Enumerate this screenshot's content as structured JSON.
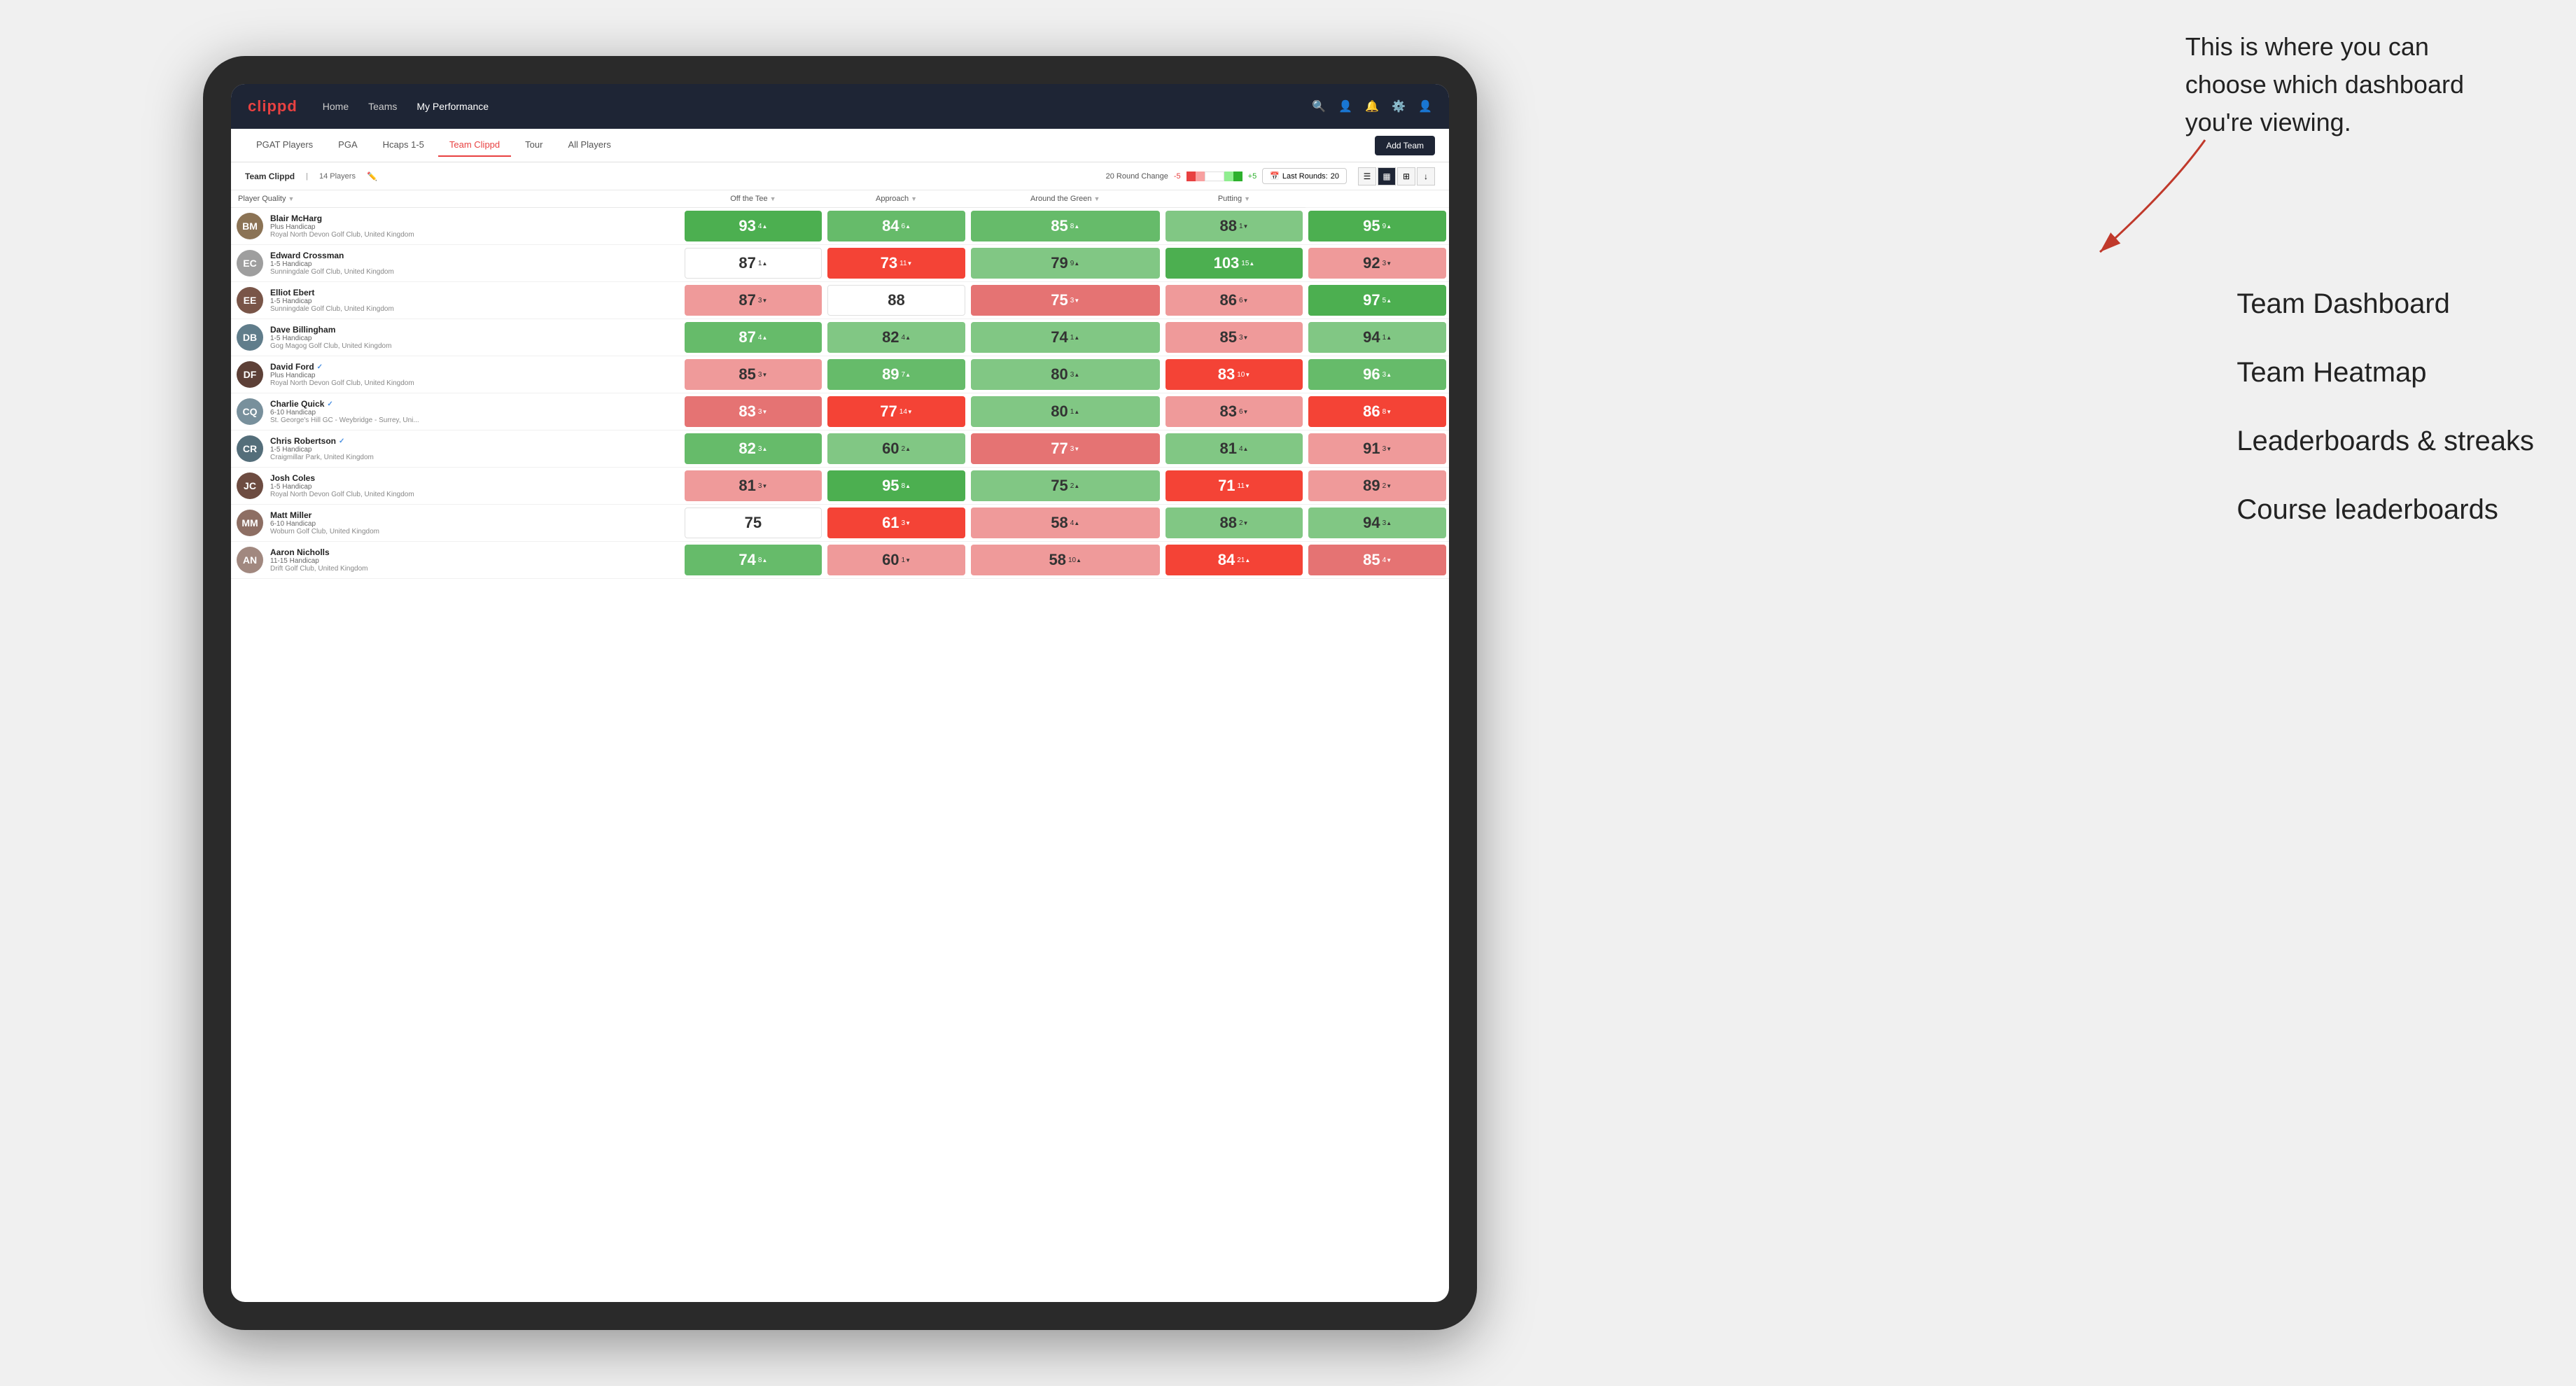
{
  "annotation": {
    "line1": "This is where you can",
    "line2": "choose which dashboard",
    "line3": "you're viewing."
  },
  "dashboard_labels": [
    "Team Dashboard",
    "Team Heatmap",
    "Leaderboards & streaks",
    "Course leaderboards"
  ],
  "nav": {
    "logo": "clippd",
    "links": [
      "Home",
      "Teams",
      "My Performance"
    ],
    "active_link": "My Performance"
  },
  "sub_tabs": {
    "tabs": [
      "PGAT Players",
      "PGA",
      "Hcaps 1-5",
      "Team Clippd",
      "Tour",
      "All Players"
    ],
    "active": "Team Clippd",
    "add_button": "Add Team"
  },
  "team_bar": {
    "name": "Team Clippd",
    "count": "14 Players",
    "round_change_label": "20 Round Change",
    "range_min": "-5",
    "range_max": "+5",
    "last_rounds_label": "Last Rounds:",
    "last_rounds_value": "20"
  },
  "table": {
    "columns": [
      "Player Quality ↓",
      "Off the Tee ↓",
      "Approach ↓",
      "Around the Green ↓",
      "Putting ↓"
    ],
    "players": [
      {
        "name": "Blair McHarg",
        "handicap": "Plus Handicap",
        "club": "Royal North Devon Golf Club, United Kingdom",
        "avatar_color": "#8B7355",
        "initials": "BM",
        "scores": [
          {
            "value": "93",
            "delta": "4",
            "dir": "up",
            "color": "c-green-1"
          },
          {
            "value": "84",
            "delta": "6",
            "dir": "up",
            "color": "c-green-2"
          },
          {
            "value": "85",
            "delta": "8",
            "dir": "up",
            "color": "c-green-2"
          },
          {
            "value": "88",
            "delta": "1",
            "dir": "down",
            "color": "c-green-3"
          },
          {
            "value": "95",
            "delta": "9",
            "dir": "up",
            "color": "c-green-1"
          }
        ]
      },
      {
        "name": "Edward Crossman",
        "handicap": "1-5 Handicap",
        "club": "Sunningdale Golf Club, United Kingdom",
        "avatar_color": "#9E9E9E",
        "initials": "EC",
        "scores": [
          {
            "value": "87",
            "delta": "1",
            "dir": "up",
            "color": "c-white"
          },
          {
            "value": "73",
            "delta": "11",
            "dir": "down",
            "color": "c-red-3"
          },
          {
            "value": "79",
            "delta": "9",
            "dir": "up",
            "color": "c-green-3"
          },
          {
            "value": "103",
            "delta": "15",
            "dir": "up",
            "color": "c-green-1"
          },
          {
            "value": "92",
            "delta": "3",
            "dir": "down",
            "color": "c-red-1"
          }
        ]
      },
      {
        "name": "Elliot Ebert",
        "handicap": "1-5 Handicap",
        "club": "Sunningdale Golf Club, United Kingdom",
        "avatar_color": "#795548",
        "initials": "EE",
        "scores": [
          {
            "value": "87",
            "delta": "3",
            "dir": "down",
            "color": "c-red-1"
          },
          {
            "value": "88",
            "delta": "",
            "dir": "",
            "color": "c-white"
          },
          {
            "value": "75",
            "delta": "3",
            "dir": "down",
            "color": "c-red-2"
          },
          {
            "value": "86",
            "delta": "6",
            "dir": "down",
            "color": "c-red-1"
          },
          {
            "value": "97",
            "delta": "5",
            "dir": "up",
            "color": "c-green-1"
          }
        ]
      },
      {
        "name": "Dave Billingham",
        "handicap": "1-5 Handicap",
        "club": "Gog Magog Golf Club, United Kingdom",
        "avatar_color": "#607D8B",
        "initials": "DB",
        "scores": [
          {
            "value": "87",
            "delta": "4",
            "dir": "up",
            "color": "c-green-2"
          },
          {
            "value": "82",
            "delta": "4",
            "dir": "up",
            "color": "c-green-3"
          },
          {
            "value": "74",
            "delta": "1",
            "dir": "up",
            "color": "c-green-3"
          },
          {
            "value": "85",
            "delta": "3",
            "dir": "down",
            "color": "c-red-1"
          },
          {
            "value": "94",
            "delta": "1",
            "dir": "up",
            "color": "c-green-3"
          }
        ]
      },
      {
        "name": "David Ford",
        "handicap": "Plus Handicap",
        "club": "Royal North Devon Golf Club, United Kingdom",
        "avatar_color": "#5D4037",
        "initials": "DF",
        "verified": true,
        "scores": [
          {
            "value": "85",
            "delta": "3",
            "dir": "down",
            "color": "c-red-1"
          },
          {
            "value": "89",
            "delta": "7",
            "dir": "up",
            "color": "c-green-2"
          },
          {
            "value": "80",
            "delta": "3",
            "dir": "up",
            "color": "c-green-3"
          },
          {
            "value": "83",
            "delta": "10",
            "dir": "down",
            "color": "c-red-3"
          },
          {
            "value": "96",
            "delta": "3",
            "dir": "up",
            "color": "c-green-2"
          }
        ]
      },
      {
        "name": "Charlie Quick",
        "handicap": "6-10 Handicap",
        "club": "St. George's Hill GC - Weybridge - Surrey, Uni...",
        "avatar_color": "#78909C",
        "initials": "CQ",
        "verified": true,
        "scores": [
          {
            "value": "83",
            "delta": "3",
            "dir": "down",
            "color": "c-red-2"
          },
          {
            "value": "77",
            "delta": "14",
            "dir": "down",
            "color": "c-red-3"
          },
          {
            "value": "80",
            "delta": "1",
            "dir": "up",
            "color": "c-green-3"
          },
          {
            "value": "83",
            "delta": "6",
            "dir": "down",
            "color": "c-red-1"
          },
          {
            "value": "86",
            "delta": "8",
            "dir": "down",
            "color": "c-red-3"
          }
        ]
      },
      {
        "name": "Chris Robertson",
        "handicap": "1-5 Handicap",
        "club": "Craigmillar Park, United Kingdom",
        "avatar_color": "#546E7A",
        "initials": "CR",
        "verified": true,
        "scores": [
          {
            "value": "82",
            "delta": "3",
            "dir": "up",
            "color": "c-green-2"
          },
          {
            "value": "60",
            "delta": "2",
            "dir": "up",
            "color": "c-green-3"
          },
          {
            "value": "77",
            "delta": "3",
            "dir": "down",
            "color": "c-red-2"
          },
          {
            "value": "81",
            "delta": "4",
            "dir": "up",
            "color": "c-green-3"
          },
          {
            "value": "91",
            "delta": "3",
            "dir": "down",
            "color": "c-red-1"
          }
        ]
      },
      {
        "name": "Josh Coles",
        "handicap": "1-5 Handicap",
        "club": "Royal North Devon Golf Club, United Kingdom",
        "avatar_color": "#6D4C41",
        "initials": "JC",
        "scores": [
          {
            "value": "81",
            "delta": "3",
            "dir": "down",
            "color": "c-red-1"
          },
          {
            "value": "95",
            "delta": "8",
            "dir": "up",
            "color": "c-green-1"
          },
          {
            "value": "75",
            "delta": "2",
            "dir": "up",
            "color": "c-green-3"
          },
          {
            "value": "71",
            "delta": "11",
            "dir": "down",
            "color": "c-red-3"
          },
          {
            "value": "89",
            "delta": "2",
            "dir": "down",
            "color": "c-red-1"
          }
        ]
      },
      {
        "name": "Matt Miller",
        "handicap": "6-10 Handicap",
        "club": "Woburn Golf Club, United Kingdom",
        "avatar_color": "#8D6E63",
        "initials": "MM",
        "scores": [
          {
            "value": "75",
            "delta": "",
            "dir": "",
            "color": "c-white"
          },
          {
            "value": "61",
            "delta": "3",
            "dir": "down",
            "color": "c-red-3"
          },
          {
            "value": "58",
            "delta": "4",
            "dir": "up",
            "color": "c-red-1"
          },
          {
            "value": "88",
            "delta": "2",
            "dir": "down",
            "color": "c-green-3"
          },
          {
            "value": "94",
            "delta": "3",
            "dir": "up",
            "color": "c-green-3"
          }
        ]
      },
      {
        "name": "Aaron Nicholls",
        "handicap": "11-15 Handicap",
        "club": "Drift Golf Club, United Kingdom",
        "avatar_color": "#A1887F",
        "initials": "AN",
        "scores": [
          {
            "value": "74",
            "delta": "8",
            "dir": "up",
            "color": "c-green-2"
          },
          {
            "value": "60",
            "delta": "1",
            "dir": "down",
            "color": "c-red-1"
          },
          {
            "value": "58",
            "delta": "10",
            "dir": "up",
            "color": "c-red-1"
          },
          {
            "value": "84",
            "delta": "21",
            "dir": "up",
            "color": "c-red-3"
          },
          {
            "value": "85",
            "delta": "4",
            "dir": "down",
            "color": "c-red-2"
          }
        ]
      }
    ]
  }
}
